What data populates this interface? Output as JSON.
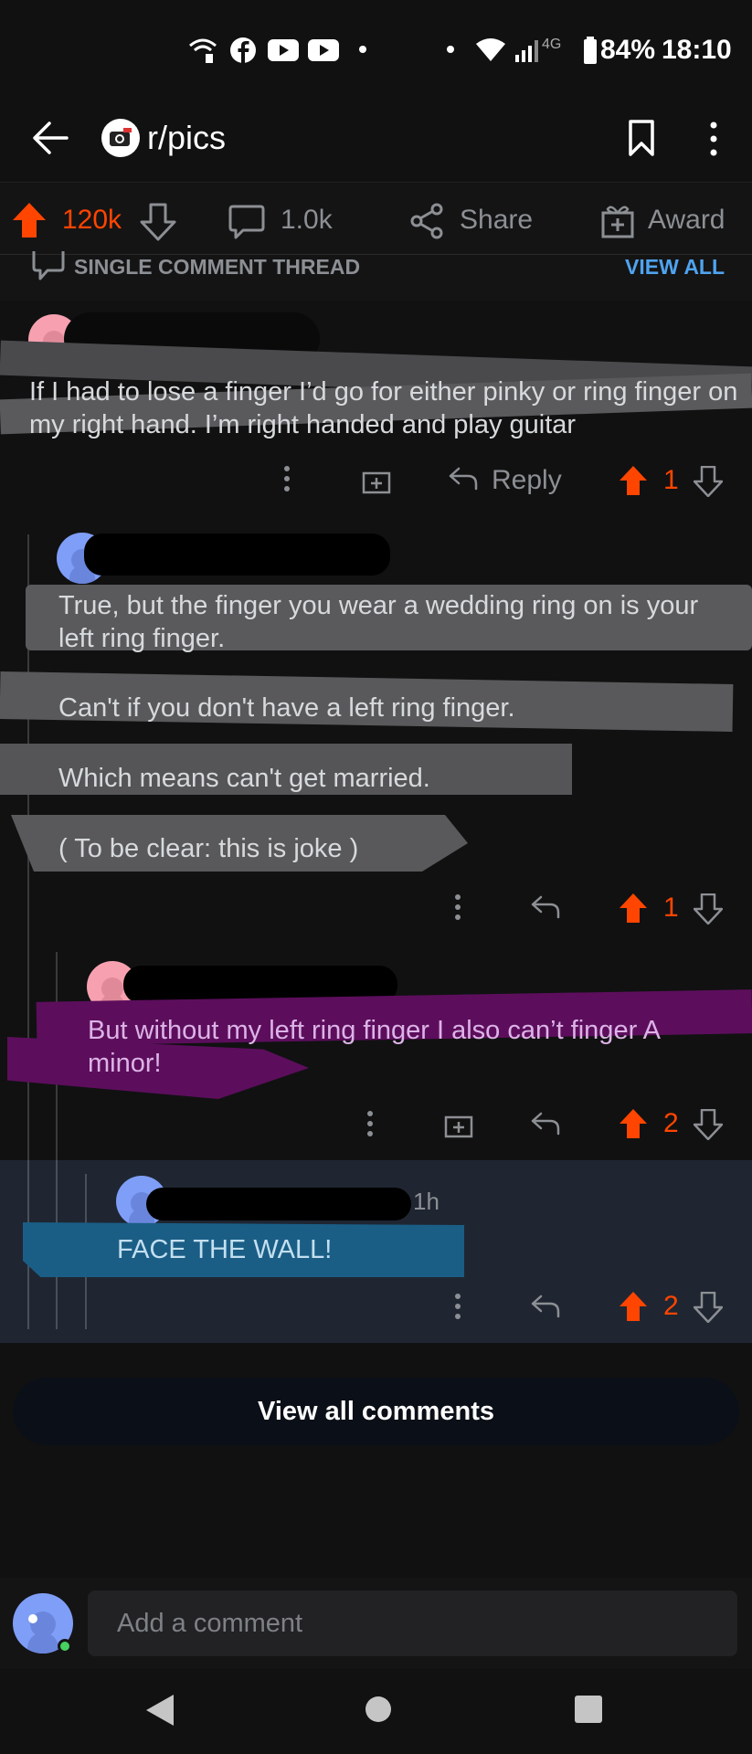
{
  "status_bar": {
    "network": "4G",
    "battery": "84%",
    "time": "18:10"
  },
  "header": {
    "subreddit": "r/pics"
  },
  "post_actions": {
    "upvotes": "120k",
    "comments": "1.0k",
    "share": "Share",
    "award": "Award"
  },
  "thread_bar": {
    "label": "SINGLE COMMENT THREAD",
    "view_all": "VIEW ALL"
  },
  "comments": [
    {
      "text": "If I had to lose a finger I’d go for either pinky or ring finger on my right hand. I’m right handed and play guitar",
      "reply_label": "Reply",
      "votes": "1"
    },
    {
      "paragraphs": [
        "True, but the finger you wear a wedding ring on is your left ring finger.",
        "Can't if you don't have a left ring finger.",
        "Which means can't get married.",
        "( To be clear: this is joke )"
      ],
      "votes": "1"
    },
    {
      "text": "But without my left ring finger I also can’t finger A minor!",
      "votes": "2"
    },
    {
      "time": "1h",
      "text": "FACE THE WALL!",
      "votes": "2"
    }
  ],
  "view_all_comments": "View all comments",
  "comment_input": {
    "placeholder": "Add a comment"
  },
  "colors": {
    "accent": "#ff4500",
    "link": "#4fa3ef",
    "background": "#111112",
    "highlight": "#1f2937"
  }
}
